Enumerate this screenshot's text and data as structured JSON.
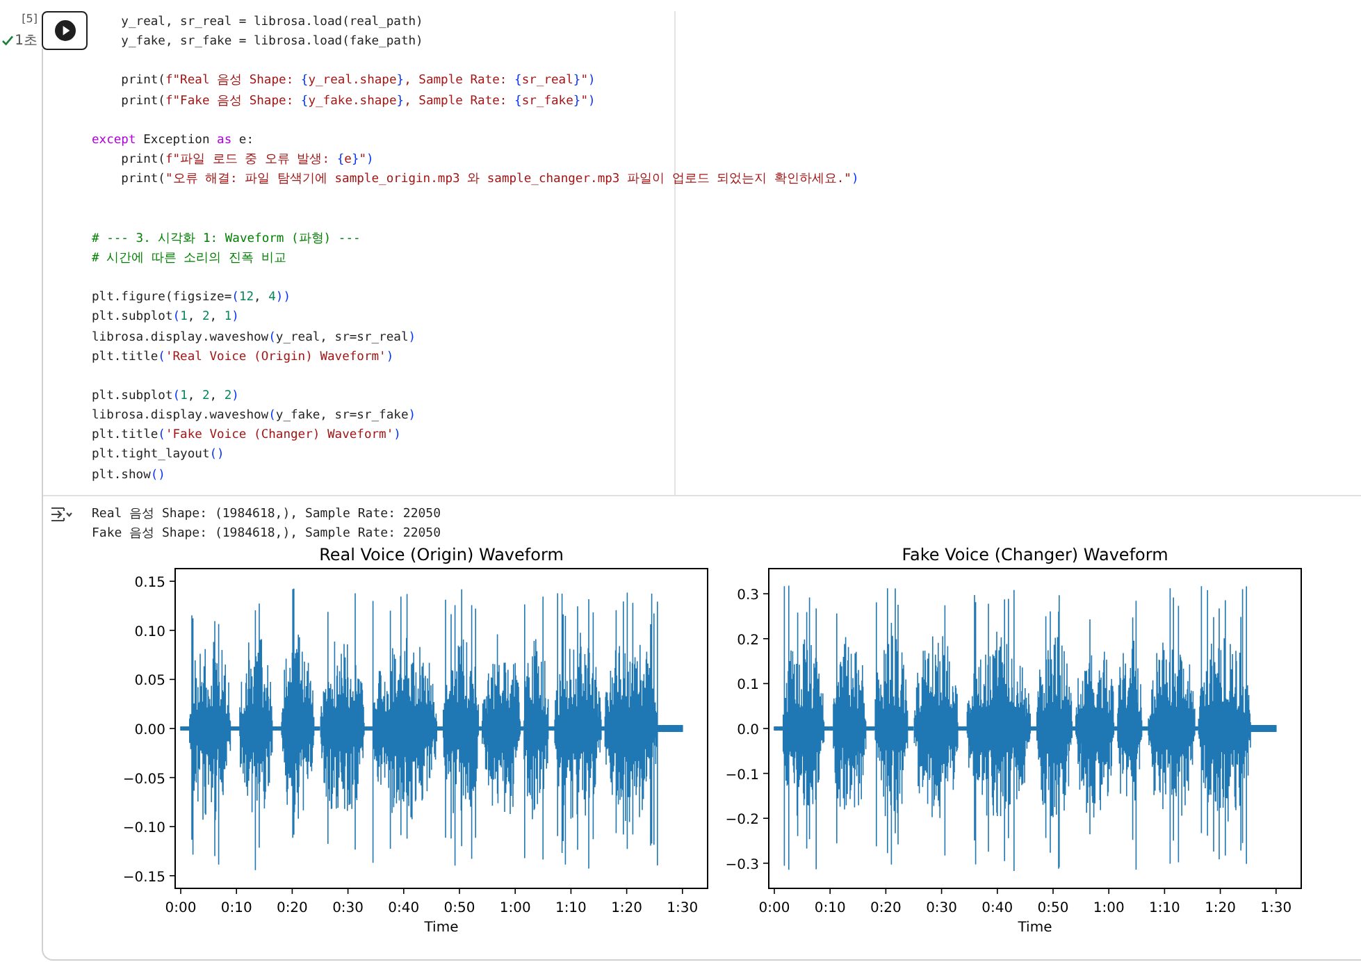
{
  "cell": {
    "execution_count": "[5]",
    "duration": "1초"
  },
  "code_lines": [
    {
      "kind": "code",
      "tokens": [
        {
          "t": "    y_real, sr_real = librosa.load(real_path)",
          "kind": "plain"
        }
      ]
    },
    {
      "kind": "code",
      "tokens": [
        {
          "t": "    y_fake, sr_fake = librosa.load(fake_path)",
          "kind": "plain"
        }
      ]
    },
    {
      "kind": "blank"
    },
    {
      "kind": "code",
      "tokens": [
        {
          "t": "    print(",
          "kind": "plain"
        },
        {
          "t": "f\"Real 음성 Shape: ",
          "kind": "string"
        },
        {
          "t": "{",
          "kind": "punct"
        },
        {
          "t": "y_real.shape",
          "kind": "string"
        },
        {
          "t": "}",
          "kind": "punct"
        },
        {
          "t": ", Sample Rate: ",
          "kind": "string"
        },
        {
          "t": "{",
          "kind": "punct"
        },
        {
          "t": "sr_real",
          "kind": "string"
        },
        {
          "t": "}",
          "kind": "punct"
        },
        {
          "t": "\"",
          "kind": "string"
        },
        {
          "t": ")",
          "kind": "punct"
        }
      ]
    },
    {
      "kind": "code",
      "tokens": [
        {
          "t": "    print(",
          "kind": "plain"
        },
        {
          "t": "f\"Fake 음성 Shape: ",
          "kind": "string"
        },
        {
          "t": "{",
          "kind": "punct"
        },
        {
          "t": "y_fake.shape",
          "kind": "string"
        },
        {
          "t": "}",
          "kind": "punct"
        },
        {
          "t": ", Sample Rate: ",
          "kind": "string"
        },
        {
          "t": "{",
          "kind": "punct"
        },
        {
          "t": "sr_fake",
          "kind": "string"
        },
        {
          "t": "}",
          "kind": "punct"
        },
        {
          "t": "\"",
          "kind": "string"
        },
        {
          "t": ")",
          "kind": "punct"
        }
      ]
    },
    {
      "kind": "blank"
    },
    {
      "kind": "code",
      "tokens": [
        {
          "t": "except",
          "kind": "keyword"
        },
        {
          "t": " Exception ",
          "kind": "plain"
        },
        {
          "t": "as",
          "kind": "keyword"
        },
        {
          "t": " e:",
          "kind": "plain"
        }
      ]
    },
    {
      "kind": "code",
      "tokens": [
        {
          "t": "    print(",
          "kind": "plain"
        },
        {
          "t": "f\"파일 로드 중 오류 발생: ",
          "kind": "string"
        },
        {
          "t": "{",
          "kind": "punct"
        },
        {
          "t": "e",
          "kind": "string"
        },
        {
          "t": "}",
          "kind": "punct"
        },
        {
          "t": "\"",
          "kind": "string"
        },
        {
          "t": ")",
          "kind": "punct"
        }
      ]
    },
    {
      "kind": "code",
      "tokens": [
        {
          "t": "    print(",
          "kind": "plain"
        },
        {
          "t": "\"오류 해결: 파일 탐색기에 sample_origin.mp3 와 sample_changer.mp3 파일이 업로드 되었는지 확인하세요.\"",
          "kind": "string"
        },
        {
          "t": ")",
          "kind": "punct"
        }
      ]
    },
    {
      "kind": "blank"
    },
    {
      "kind": "blank"
    },
    {
      "kind": "code",
      "tokens": [
        {
          "t": "# --- 3. 시각화 1: Waveform (파형) ---",
          "kind": "comment"
        }
      ]
    },
    {
      "kind": "code",
      "tokens": [
        {
          "t": "# 시간에 따른 소리의 진폭 비교",
          "kind": "comment"
        }
      ]
    },
    {
      "kind": "blank"
    },
    {
      "kind": "code",
      "tokens": [
        {
          "t": "plt.figure(figsize=",
          "kind": "plain"
        },
        {
          "t": "(",
          "kind": "punct"
        },
        {
          "t": "12",
          "kind": "number"
        },
        {
          "t": ", ",
          "kind": "plain"
        },
        {
          "t": "4",
          "kind": "number"
        },
        {
          "t": "))",
          "kind": "punct"
        }
      ]
    },
    {
      "kind": "code",
      "tokens": [
        {
          "t": "plt.subplot",
          "kind": "plain"
        },
        {
          "t": "(",
          "kind": "punct"
        },
        {
          "t": "1",
          "kind": "number"
        },
        {
          "t": ", ",
          "kind": "plain"
        },
        {
          "t": "2",
          "kind": "number"
        },
        {
          "t": ", ",
          "kind": "plain"
        },
        {
          "t": "1",
          "kind": "number"
        },
        {
          "t": ")",
          "kind": "punct"
        }
      ]
    },
    {
      "kind": "code",
      "tokens": [
        {
          "t": "librosa.display.waveshow",
          "kind": "plain"
        },
        {
          "t": "(",
          "kind": "punct"
        },
        {
          "t": "y_real, sr=sr_real",
          "kind": "plain"
        },
        {
          "t": ")",
          "kind": "punct"
        }
      ]
    },
    {
      "kind": "code",
      "tokens": [
        {
          "t": "plt.title",
          "kind": "plain"
        },
        {
          "t": "(",
          "kind": "punct"
        },
        {
          "t": "'Real Voice (Origin) Waveform'",
          "kind": "string"
        },
        {
          "t": ")",
          "kind": "punct"
        }
      ]
    },
    {
      "kind": "blank"
    },
    {
      "kind": "code",
      "tokens": [
        {
          "t": "plt.subplot",
          "kind": "plain"
        },
        {
          "t": "(",
          "kind": "punct"
        },
        {
          "t": "1",
          "kind": "number"
        },
        {
          "t": ", ",
          "kind": "plain"
        },
        {
          "t": "2",
          "kind": "number"
        },
        {
          "t": ", ",
          "kind": "plain"
        },
        {
          "t": "2",
          "kind": "number"
        },
        {
          "t": ")",
          "kind": "punct"
        }
      ]
    },
    {
      "kind": "code",
      "tokens": [
        {
          "t": "librosa.display.waveshow",
          "kind": "plain"
        },
        {
          "t": "(",
          "kind": "punct"
        },
        {
          "t": "y_fake, sr=sr_fake",
          "kind": "plain"
        },
        {
          "t": ")",
          "kind": "punct"
        }
      ]
    },
    {
      "kind": "code",
      "tokens": [
        {
          "t": "plt.title",
          "kind": "plain"
        },
        {
          "t": "(",
          "kind": "punct"
        },
        {
          "t": "'Fake Voice (Changer) Waveform'",
          "kind": "string"
        },
        {
          "t": ")",
          "kind": "punct"
        }
      ]
    },
    {
      "kind": "code",
      "tokens": [
        {
          "t": "plt.tight_layout",
          "kind": "plain"
        },
        {
          "t": "()",
          "kind": "punct"
        }
      ]
    },
    {
      "kind": "code",
      "tokens": [
        {
          "t": "plt.show",
          "kind": "plain"
        },
        {
          "t": "()",
          "kind": "punct"
        }
      ]
    }
  ],
  "output": {
    "lines": [
      "Real 음성 Shape: (1984618,), Sample Rate: 22050",
      "Fake 음성 Shape: (1984618,), Sample Rate: 22050"
    ],
    "plots": [
      {
        "title": "Real Voice (Origin) Waveform",
        "y_tick_labels": [
          "0.15",
          "0.10",
          "0.05",
          "0.00",
          "−0.05",
          "−0.10",
          "−0.15"
        ],
        "x_tick_labels": [
          "0:00",
          "0:10",
          "0:20",
          "0:30",
          "0:40",
          "0:50",
          "1:00",
          "1:10",
          "1:20",
          "1:30"
        ],
        "xlabel": "Time"
      },
      {
        "title": "Fake Voice (Changer) Waveform",
        "y_tick_labels": [
          "0.3",
          "0.2",
          "0.1",
          "0.0",
          "−0.1",
          "−0.2",
          "−0.3"
        ],
        "x_tick_labels": [
          "0:00",
          "0:10",
          "0:20",
          "0:30",
          "0:40",
          "0:50",
          "1:00",
          "1:10",
          "1:20",
          "1:30"
        ],
        "xlabel": "Time"
      }
    ]
  }
}
